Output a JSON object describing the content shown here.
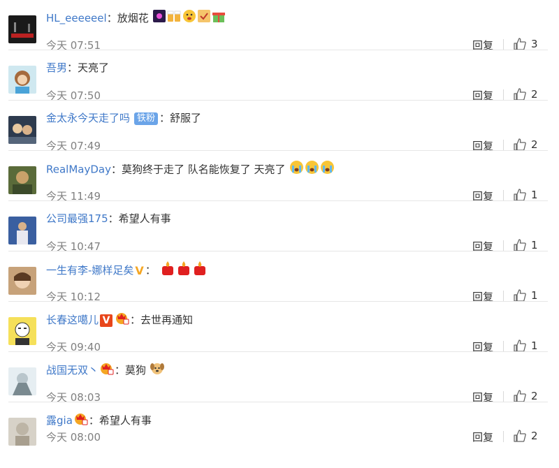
{
  "comments": [
    {
      "name": "HL_eeeeeel",
      "badge": "",
      "vmark": "",
      "text": "放烟花",
      "time": "今天 07:51",
      "reply": "回复",
      "likes": "3"
    },
    {
      "name": "吾男",
      "badge": "",
      "vmark": "",
      "text": "天亮了",
      "time": "今天 07:50",
      "reply": "回复",
      "likes": "2"
    },
    {
      "name": "金太永今天走了吗",
      "badge": "铁粉",
      "vmark": "",
      "text": "舒服了",
      "time": "今天 07:49",
      "reply": "回复",
      "likes": "2"
    },
    {
      "name": "RealMayDay",
      "badge": "",
      "vmark": "",
      "text": "莫狗终于走了 队名能恢复了 天亮了",
      "time": "今天 11:49",
      "reply": "回复",
      "likes": "1"
    },
    {
      "name": "公司最强175",
      "badge": "",
      "vmark": "",
      "text": "希望人有事",
      "time": "今天 10:47",
      "reply": "回复",
      "likes": "1"
    },
    {
      "name": "一生有李-娜样足矣",
      "badge": "",
      "vmark": "V",
      "text": "",
      "time": "今天 10:12",
      "reply": "回复",
      "likes": "1"
    },
    {
      "name": "长春这噶儿",
      "badge": "",
      "vmark": "V",
      "text": "去世再通知",
      "time": "今天 09:40",
      "reply": "回复",
      "likes": "1"
    },
    {
      "name": "战国无双丶",
      "badge": "",
      "vmark": "",
      "text": "莫狗",
      "time": "今天 08:03",
      "reply": "回复",
      "likes": "2"
    },
    {
      "name": "露gia",
      "badge": "",
      "vmark": "",
      "text": "希望人有事",
      "time": "今天 08:00",
      "reply": "回复",
      "likes": "2"
    }
  ],
  "colon": "："
}
